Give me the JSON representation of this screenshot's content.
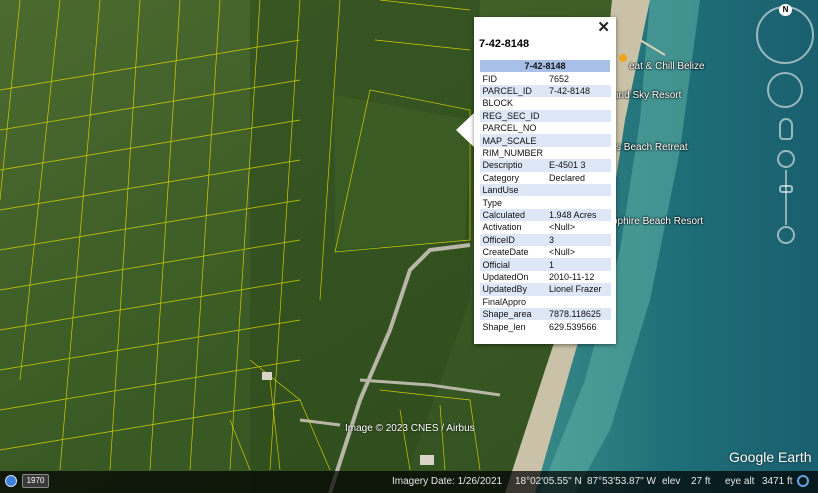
{
  "popup": {
    "title": "7-42-8148",
    "close_glyph": "✕",
    "table_header": "7-42-8148",
    "rows": [
      {
        "key": "FID",
        "value": "7652"
      },
      {
        "key": "PARCEL_ID",
        "value": "7-42-8148"
      },
      {
        "key": "BLOCK",
        "value": ""
      },
      {
        "key": "REG_SEC_ID",
        "value": ""
      },
      {
        "key": "PARCEL_NO",
        "value": ""
      },
      {
        "key": "MAP_SCALE",
        "value": ""
      },
      {
        "key": "RIM_NUMBER",
        "value": ""
      },
      {
        "key": "Descriptio",
        "value": "E-4501 3"
      },
      {
        "key": "Category",
        "value": "Declared"
      },
      {
        "key": "LandUse",
        "value": ""
      },
      {
        "key": "Type",
        "value": ""
      },
      {
        "key": "Calculated",
        "value": "1.948 Acres"
      },
      {
        "key": "Activation",
        "value": "<Null>"
      },
      {
        "key": "OfficeID",
        "value": "3"
      },
      {
        "key": "CreateDate",
        "value": "<Null>"
      },
      {
        "key": "Official",
        "value": "1"
      },
      {
        "key": "UpdatedOn",
        "value": "2010-11-12"
      },
      {
        "key": "UpdatedBy",
        "value": "Lionel Frazer"
      },
      {
        "key": "FinalAppro",
        "value": ""
      },
      {
        "key": "Shape_area",
        "value": "7878.118625"
      },
      {
        "key": "Shape_len",
        "value": "629.539566"
      }
    ]
  },
  "places": [
    {
      "name": "place-chill-belize",
      "label": "eat & Chill Belize"
    },
    {
      "name": "place-sky-resort",
      "label": "and Sky Resort"
    },
    {
      "name": "place-beach-retreat",
      "label": "s Beach Retreat"
    },
    {
      "name": "place-sapphire-resort",
      "label": "pphire Beach Resort"
    }
  ],
  "nav": {
    "north": "N"
  },
  "timeline": {
    "year": "1970"
  },
  "status": {
    "imagery_date": "Imagery Date: 1/26/2021",
    "lat": "18°02'05.55\" N",
    "lon": "87°53'53.87\" W",
    "elev_label": "elev",
    "elev_value": "27 ft",
    "eye_label": "eye alt",
    "eye_value": "3471 ft"
  },
  "copyright": "Image © 2023 CNES / Airbus",
  "brand": "Google Earth",
  "colors": {
    "parcel_line": "#e6e000",
    "popup_header": "#a8c0e8",
    "popup_alt_row": "#dde7f6"
  }
}
